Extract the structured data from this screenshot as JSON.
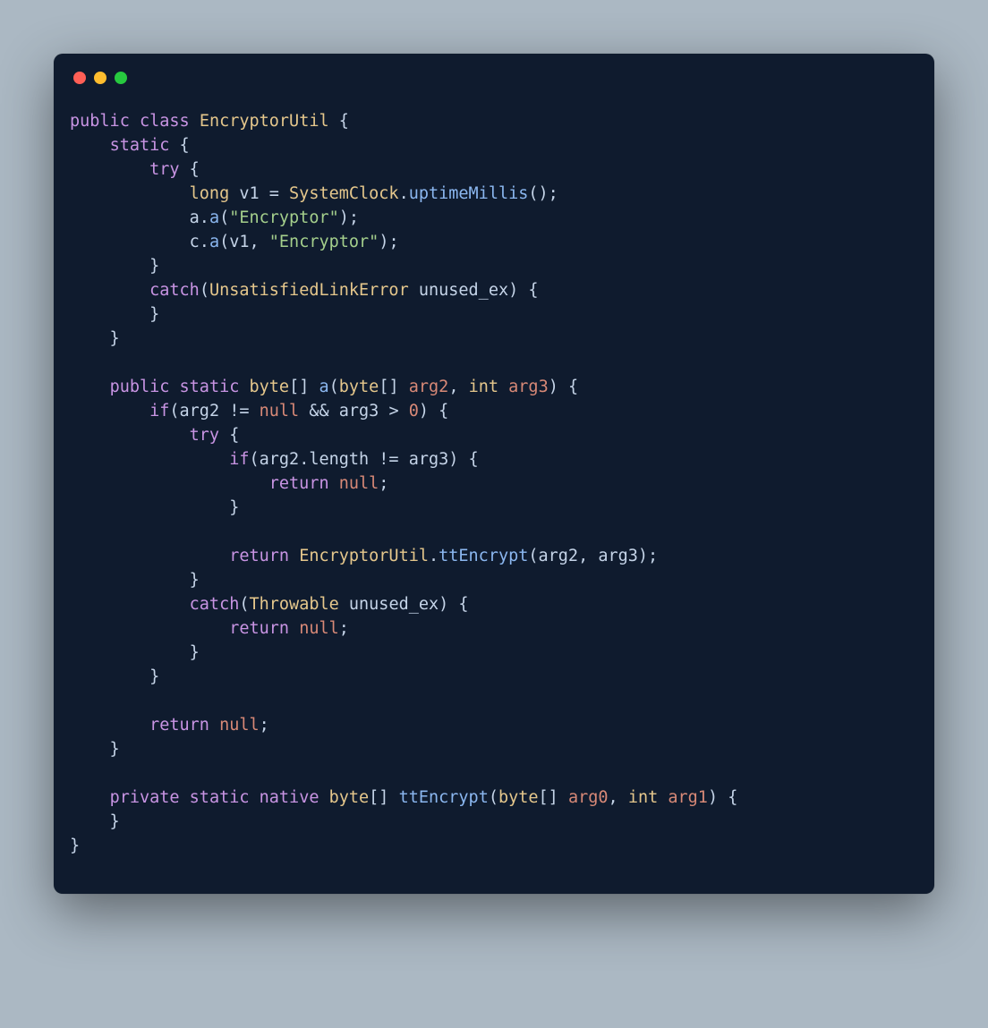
{
  "code": {
    "tokens": [
      {
        "t": "public",
        "c": "kw"
      },
      {
        "t": " ",
        "c": "plain"
      },
      {
        "t": "class",
        "c": "kw"
      },
      {
        "t": " ",
        "c": "plain"
      },
      {
        "t": "EncryptorUtil",
        "c": "type"
      },
      {
        "t": " {\n",
        "c": "plain"
      },
      {
        "t": "    ",
        "c": "plain"
      },
      {
        "t": "static",
        "c": "kw"
      },
      {
        "t": " {\n",
        "c": "plain"
      },
      {
        "t": "        ",
        "c": "plain"
      },
      {
        "t": "try",
        "c": "kw"
      },
      {
        "t": " {\n",
        "c": "plain"
      },
      {
        "t": "            ",
        "c": "plain"
      },
      {
        "t": "long",
        "c": "type"
      },
      {
        "t": " v1 = ",
        "c": "plain"
      },
      {
        "t": "SystemClock",
        "c": "type"
      },
      {
        "t": ".",
        "c": "plain"
      },
      {
        "t": "uptimeMillis",
        "c": "fn"
      },
      {
        "t": "();\n",
        "c": "plain"
      },
      {
        "t": "            a.",
        "c": "plain"
      },
      {
        "t": "a",
        "c": "fn"
      },
      {
        "t": "(",
        "c": "plain"
      },
      {
        "t": "\"Encryptor\"",
        "c": "str"
      },
      {
        "t": ");\n",
        "c": "plain"
      },
      {
        "t": "            c.",
        "c": "plain"
      },
      {
        "t": "a",
        "c": "fn"
      },
      {
        "t": "(v1, ",
        "c": "plain"
      },
      {
        "t": "\"Encryptor\"",
        "c": "str"
      },
      {
        "t": ");\n",
        "c": "plain"
      },
      {
        "t": "        }\n",
        "c": "plain"
      },
      {
        "t": "        ",
        "c": "plain"
      },
      {
        "t": "catch",
        "c": "kw"
      },
      {
        "t": "(",
        "c": "plain"
      },
      {
        "t": "UnsatisfiedLinkError",
        "c": "type"
      },
      {
        "t": " unused_ex) {\n",
        "c": "plain"
      },
      {
        "t": "        }\n",
        "c": "plain"
      },
      {
        "t": "    }\n",
        "c": "plain"
      },
      {
        "t": "\n",
        "c": "plain"
      },
      {
        "t": "    ",
        "c": "plain"
      },
      {
        "t": "public",
        "c": "kw"
      },
      {
        "t": " ",
        "c": "plain"
      },
      {
        "t": "static",
        "c": "kw"
      },
      {
        "t": " ",
        "c": "plain"
      },
      {
        "t": "byte",
        "c": "type"
      },
      {
        "t": "[] ",
        "c": "plain"
      },
      {
        "t": "a",
        "c": "fn"
      },
      {
        "t": "(",
        "c": "plain"
      },
      {
        "t": "byte",
        "c": "type"
      },
      {
        "t": "[] ",
        "c": "plain"
      },
      {
        "t": "arg2",
        "c": "param"
      },
      {
        "t": ", ",
        "c": "plain"
      },
      {
        "t": "int",
        "c": "type"
      },
      {
        "t": " ",
        "c": "plain"
      },
      {
        "t": "arg3",
        "c": "param"
      },
      {
        "t": ") {\n",
        "c": "plain"
      },
      {
        "t": "        ",
        "c": "plain"
      },
      {
        "t": "if",
        "c": "kw"
      },
      {
        "t": "(arg2 != ",
        "c": "plain"
      },
      {
        "t": "null",
        "c": "null"
      },
      {
        "t": " && arg3 > ",
        "c": "plain"
      },
      {
        "t": "0",
        "c": "num"
      },
      {
        "t": ") {\n",
        "c": "plain"
      },
      {
        "t": "            ",
        "c": "plain"
      },
      {
        "t": "try",
        "c": "kw"
      },
      {
        "t": " {\n",
        "c": "plain"
      },
      {
        "t": "                ",
        "c": "plain"
      },
      {
        "t": "if",
        "c": "kw"
      },
      {
        "t": "(arg2.length != arg3) {\n",
        "c": "plain"
      },
      {
        "t": "                    ",
        "c": "plain"
      },
      {
        "t": "return",
        "c": "kw"
      },
      {
        "t": " ",
        "c": "plain"
      },
      {
        "t": "null",
        "c": "null"
      },
      {
        "t": ";\n",
        "c": "plain"
      },
      {
        "t": "                }\n",
        "c": "plain"
      },
      {
        "t": "\n",
        "c": "plain"
      },
      {
        "t": "                ",
        "c": "plain"
      },
      {
        "t": "return",
        "c": "kw"
      },
      {
        "t": " ",
        "c": "plain"
      },
      {
        "t": "EncryptorUtil",
        "c": "type"
      },
      {
        "t": ".",
        "c": "plain"
      },
      {
        "t": "ttEncrypt",
        "c": "fn"
      },
      {
        "t": "(arg2, arg3);\n",
        "c": "plain"
      },
      {
        "t": "            }\n",
        "c": "plain"
      },
      {
        "t": "            ",
        "c": "plain"
      },
      {
        "t": "catch",
        "c": "kw"
      },
      {
        "t": "(",
        "c": "plain"
      },
      {
        "t": "Throwable",
        "c": "type"
      },
      {
        "t": " unused_ex) {\n",
        "c": "plain"
      },
      {
        "t": "                ",
        "c": "plain"
      },
      {
        "t": "return",
        "c": "kw"
      },
      {
        "t": " ",
        "c": "plain"
      },
      {
        "t": "null",
        "c": "null"
      },
      {
        "t": ";\n",
        "c": "plain"
      },
      {
        "t": "            }\n",
        "c": "plain"
      },
      {
        "t": "        }\n",
        "c": "plain"
      },
      {
        "t": "\n",
        "c": "plain"
      },
      {
        "t": "        ",
        "c": "plain"
      },
      {
        "t": "return",
        "c": "kw"
      },
      {
        "t": " ",
        "c": "plain"
      },
      {
        "t": "null",
        "c": "null"
      },
      {
        "t": ";\n",
        "c": "plain"
      },
      {
        "t": "    }\n",
        "c": "plain"
      },
      {
        "t": "\n",
        "c": "plain"
      },
      {
        "t": "    ",
        "c": "plain"
      },
      {
        "t": "private",
        "c": "kw"
      },
      {
        "t": " ",
        "c": "plain"
      },
      {
        "t": "static",
        "c": "kw"
      },
      {
        "t": " ",
        "c": "plain"
      },
      {
        "t": "native",
        "c": "kw"
      },
      {
        "t": " ",
        "c": "plain"
      },
      {
        "t": "byte",
        "c": "type"
      },
      {
        "t": "[] ",
        "c": "plain"
      },
      {
        "t": "ttEncrypt",
        "c": "fn"
      },
      {
        "t": "(",
        "c": "plain"
      },
      {
        "t": "byte",
        "c": "type"
      },
      {
        "t": "[] ",
        "c": "plain"
      },
      {
        "t": "arg0",
        "c": "param"
      },
      {
        "t": ", ",
        "c": "plain"
      },
      {
        "t": "int",
        "c": "type"
      },
      {
        "t": " ",
        "c": "plain"
      },
      {
        "t": "arg1",
        "c": "param"
      },
      {
        "t": ") {\n",
        "c": "plain"
      },
      {
        "t": "    }\n",
        "c": "plain"
      },
      {
        "t": "}",
        "c": "plain"
      }
    ]
  }
}
